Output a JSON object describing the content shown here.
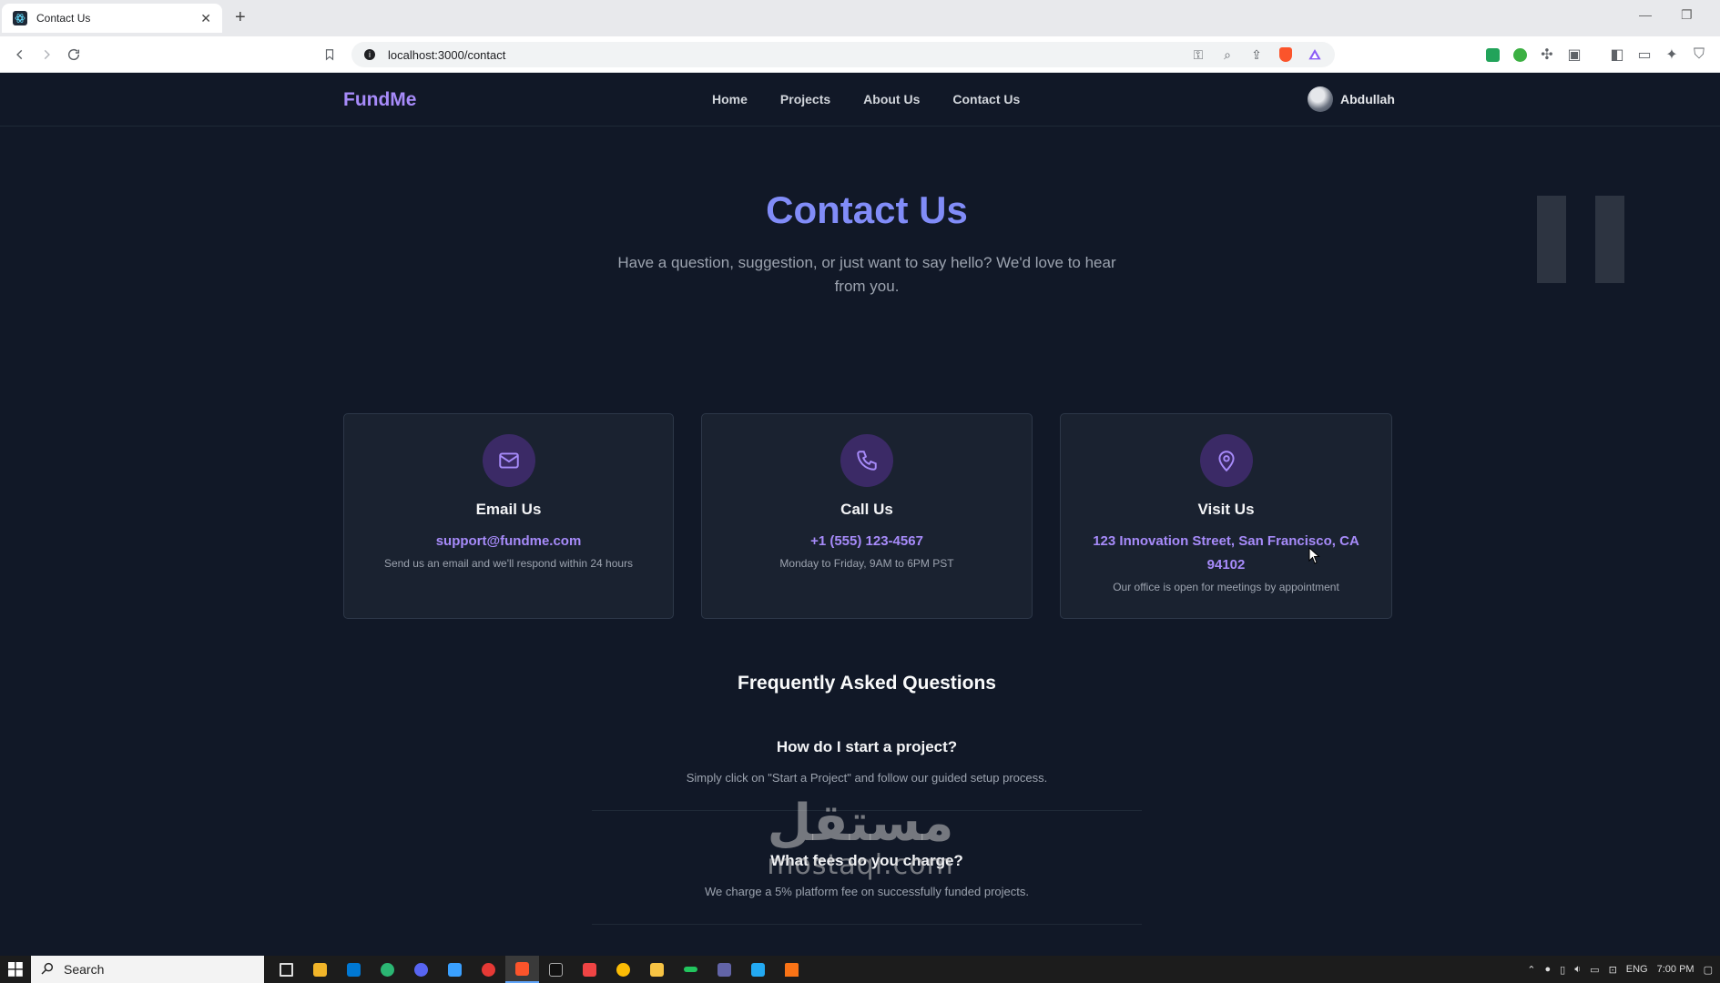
{
  "browser": {
    "tab_title": "Contact Us",
    "url": "localhost:3000/contact"
  },
  "nav": {
    "logo": "FundMe",
    "links": [
      "Home",
      "Projects",
      "About Us",
      "Contact Us"
    ],
    "user_name": "Abdullah"
  },
  "hero": {
    "title": "Contact Us",
    "subtitle": "Have a question, suggestion, or just want to say hello? We'd love to hear from you."
  },
  "cards": [
    {
      "icon": "mail-icon",
      "title": "Email Us",
      "value": "support@fundme.com",
      "desc": "Send us an email and we'll respond within 24 hours"
    },
    {
      "icon": "phone-icon",
      "title": "Call Us",
      "value": "+1 (555) 123-4567",
      "desc": "Monday to Friday, 9AM to 6PM PST"
    },
    {
      "icon": "map-pin-icon",
      "title": "Visit Us",
      "value": "123 Innovation Street, San Francisco, CA 94102",
      "desc": "Our office is open for meetings by appointment"
    }
  ],
  "faq": {
    "title": "Frequently Asked Questions",
    "items": [
      {
        "q": "How do I start a project?",
        "a": "Simply click on \"Start a Project\" and follow our guided setup process."
      },
      {
        "q": "What fees do you charge?",
        "a": "We charge a 5% platform fee on successfully funded projects."
      }
    ]
  },
  "watermark": {
    "arabic": "مستقل",
    "latin": "mostaql.com"
  },
  "taskbar": {
    "search_label": "Search",
    "language": "ENG",
    "time": "7:00 PM"
  },
  "colors": {
    "accent": "#a78bfa",
    "title": "#818cf8",
    "background": "#111827"
  }
}
